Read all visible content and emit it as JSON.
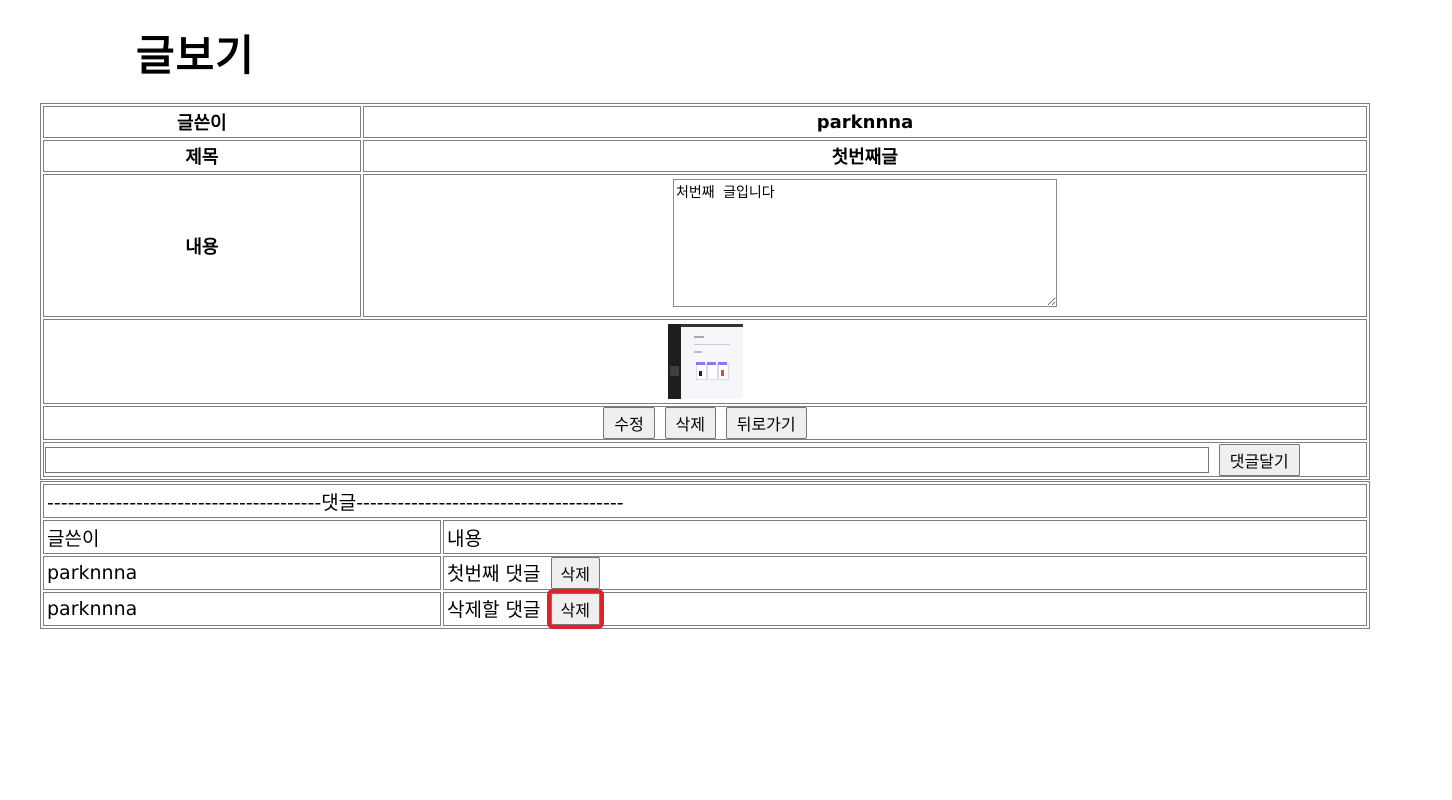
{
  "page": {
    "title": "글보기"
  },
  "post": {
    "author_label": "글쓴이",
    "author_value": "parknnna",
    "title_label": "제목",
    "title_value": "첫번째글",
    "content_label": "내용",
    "content_value": "처번째 글입니다"
  },
  "actions": {
    "edit_label": "수정",
    "delete_label": "삭제",
    "back_label": "뒤로가기"
  },
  "comment_form": {
    "input_value": "",
    "submit_label": "댓글달기"
  },
  "comments": {
    "separator": "----------------------------------------댓글---------------------------------------",
    "header_author": "글쓴이",
    "header_content": "내용",
    "rows": [
      {
        "author": "parknnna",
        "content": "첫번째 댓글",
        "delete_label": "삭제"
      },
      {
        "author": "parknnna",
        "content": "삭제할 댓글",
        "delete_label": "삭제"
      }
    ]
  },
  "colors": {
    "highlight": "#e0202a"
  }
}
